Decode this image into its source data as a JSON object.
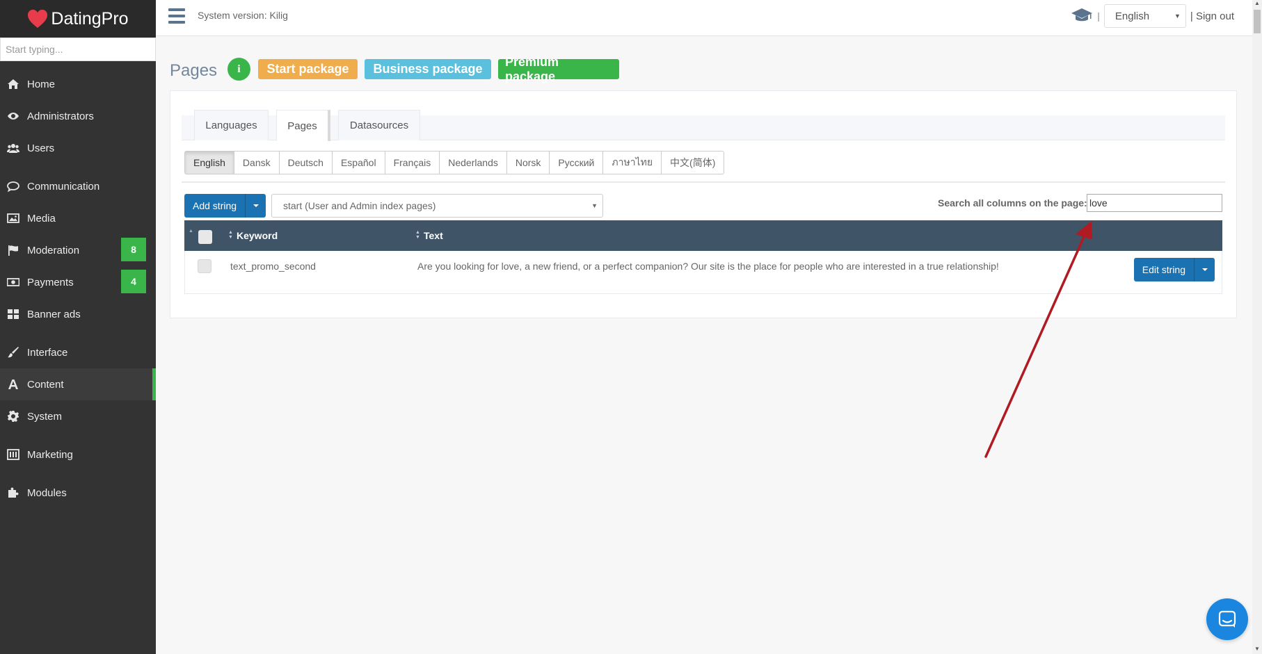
{
  "brand": {
    "name": "DatingPro"
  },
  "sidebar": {
    "search_placeholder": "Start typing...",
    "items": [
      {
        "label": "Home"
      },
      {
        "label": "Administrators"
      },
      {
        "label": "Users"
      },
      {
        "label": "Communication"
      },
      {
        "label": "Media"
      },
      {
        "label": "Moderation",
        "badge": "8"
      },
      {
        "label": "Payments",
        "badge": "4"
      },
      {
        "label": "Banner ads"
      },
      {
        "label": "Interface"
      },
      {
        "label": "Content",
        "active": true
      },
      {
        "label": "System"
      },
      {
        "label": "Marketing"
      },
      {
        "label": "Modules"
      }
    ]
  },
  "topbar": {
    "system_version": "System version: Kilig",
    "separator": "|",
    "language": "English",
    "signout": "| Sign out"
  },
  "page": {
    "title": "Pages",
    "info": "i",
    "packages": {
      "start": "Start package",
      "business": "Business package",
      "premium": "Premium package"
    }
  },
  "tabs": [
    {
      "label": "Languages"
    },
    {
      "label": "Pages",
      "active": true
    },
    {
      "label": "Datasources"
    }
  ],
  "languages": [
    "English",
    "Dansk",
    "Deutsch",
    "Español",
    "Français",
    "Nederlands",
    "Norsk",
    "Русский",
    "ภาษาไทย",
    "中文(简体)"
  ],
  "toolbar": {
    "add_string": "Add string",
    "page_select": "start (User and Admin index pages)",
    "search_label": "Search all columns on the page:",
    "search_value": "love"
  },
  "table": {
    "headers": {
      "keyword": "Keyword",
      "text": "Text"
    },
    "rows": [
      {
        "keyword": "text_promo_second",
        "text": "Are you looking for love, a new friend, or a perfect companion? Our site is the place for people who are interested in a true relationship!",
        "action": "Edit string"
      }
    ]
  },
  "colors": {
    "sidebar_bg": "#333333",
    "accent_green": "#3ab54a",
    "primary_blue": "#1a72b3",
    "table_header": "#405467",
    "annotation_arrow": "#b01a22"
  }
}
